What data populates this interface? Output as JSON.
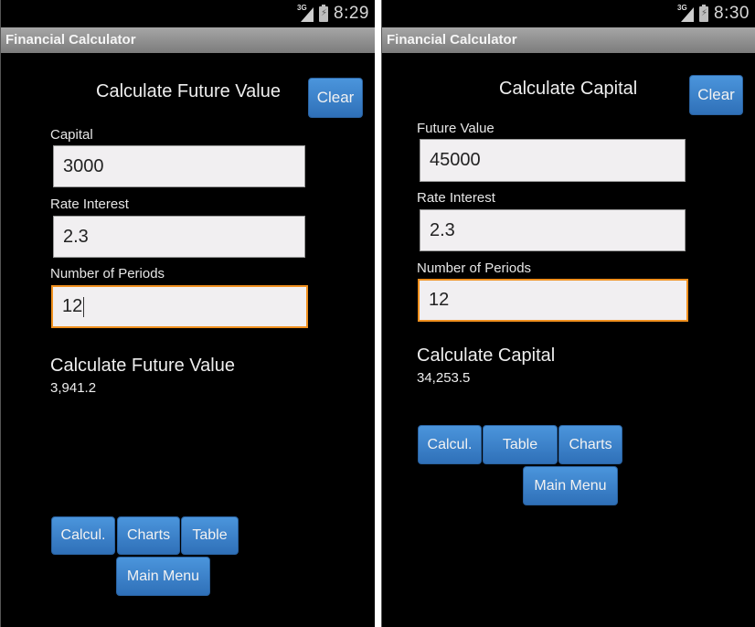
{
  "screens": [
    {
      "status": {
        "network": "3G",
        "time": "8:29"
      },
      "app_title": "Financial Calculator",
      "heading": "Calculate Future Value",
      "clear_label": "Clear",
      "fields": [
        {
          "label": "Capital",
          "value": "3000",
          "focused": false
        },
        {
          "label": "Rate Interest",
          "value": "2.3",
          "focused": false
        },
        {
          "label": "Number of Periods",
          "value": "12",
          "focused": true
        }
      ],
      "result": {
        "title": "Calculate Future Value",
        "value": "3,941.2"
      },
      "buttons": [
        "Calcul.",
        "Charts",
        "Table"
      ],
      "main_menu_label": "Main Menu"
    },
    {
      "status": {
        "network": "3G",
        "time": "8:30"
      },
      "app_title": "Financial Calculator",
      "heading": "Calculate Capital",
      "clear_label": "Clear",
      "fields": [
        {
          "label": "Future Value",
          "value": "45000",
          "focused": false
        },
        {
          "label": "Rate Interest",
          "value": "2.3",
          "focused": false
        },
        {
          "label": "Number of Periods",
          "value": "12",
          "focused": true
        }
      ],
      "result": {
        "title": "Calculate Capital",
        "value": "34,253.5"
      },
      "buttons": [
        "Calcul.",
        "Table",
        "Charts"
      ],
      "main_menu_label": "Main Menu"
    }
  ],
  "colors": {
    "button": "#3a82cc",
    "focus": "#f0901e",
    "titlebar": "#8e8e8e"
  }
}
